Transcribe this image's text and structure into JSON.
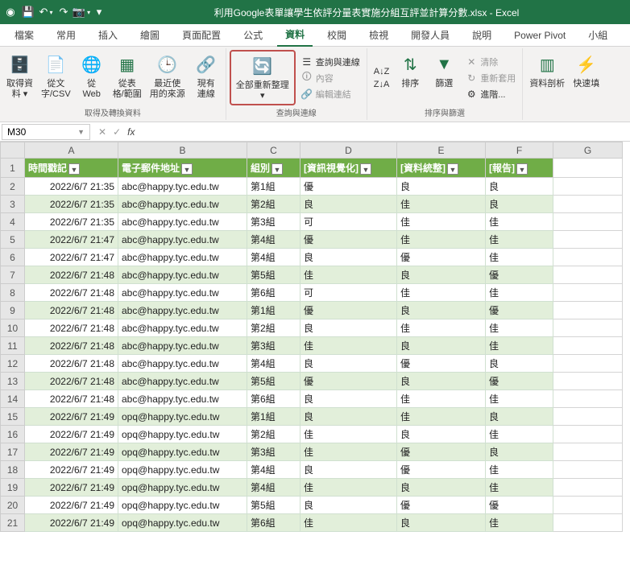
{
  "title": "利用Google表單讓學生依評分量表實施分組互評並計算分數.xlsx - Excel",
  "menuTabs": {
    "file": "檔案",
    "home": "常用",
    "insert": "插入",
    "draw": "繪圖",
    "pageLayout": "頁面配置",
    "formulas": "公式",
    "data": "資料",
    "review": "校閱",
    "view": "檢視",
    "developer": "開發人員",
    "help": "說明",
    "powerPivot": "Power Pivot",
    "team": "小組"
  },
  "ribbon": {
    "getData": "取得資\n料 ▾",
    "fromTextCsv": "從文\n字/CSV",
    "fromWeb": "從\nWeb",
    "fromTable": "從表\n格/範圍",
    "recentSources": "最近使\n用的來源",
    "existingConnections": "現有\n連線",
    "getTransformLabel": "取得及轉換資料",
    "refreshAll": "全部重新整理\n▾",
    "queriesConnections": "查詢與連線",
    "properties": "內容",
    "editLinks": "編輯連結",
    "queriesLabel": "查詢與連線",
    "sortAZ": "A↓Z",
    "sortZA": "Z↓A",
    "sort": "排序",
    "filter": "篩選",
    "clear": "清除",
    "reapply": "重新套用",
    "advanced": "進階...",
    "sortFilterLabel": "排序與篩選",
    "textToColumns": "資料剖析",
    "flashFill": "快速填"
  },
  "nameBox": "M30",
  "columns": [
    "A",
    "B",
    "C",
    "D",
    "E",
    "F",
    "G"
  ],
  "headers": {
    "timestamp": "時間戳記",
    "email": "電子郵件地址",
    "group": "組別",
    "infoVis": "[資訊視覺化]",
    "dataOrg": "[資料統整]",
    "report": "[報告]"
  },
  "rows": [
    {
      "ts": "2022/6/7 21:35",
      "email": "abc@happy.tyc.edu.tw",
      "grp": "第1組",
      "v1": "優",
      "v2": "良",
      "v3": "良"
    },
    {
      "ts": "2022/6/7 21:35",
      "email": "abc@happy.tyc.edu.tw",
      "grp": "第2組",
      "v1": "良",
      "v2": "佳",
      "v3": "良"
    },
    {
      "ts": "2022/6/7 21:35",
      "email": "abc@happy.tyc.edu.tw",
      "grp": "第3組",
      "v1": "可",
      "v2": "佳",
      "v3": "佳"
    },
    {
      "ts": "2022/6/7 21:47",
      "email": "abc@happy.tyc.edu.tw",
      "grp": "第4組",
      "v1": "優",
      "v2": "佳",
      "v3": "佳"
    },
    {
      "ts": "2022/6/7 21:47",
      "email": "abc@happy.tyc.edu.tw",
      "grp": "第4組",
      "v1": "良",
      "v2": "優",
      "v3": "佳"
    },
    {
      "ts": "2022/6/7 21:48",
      "email": "abc@happy.tyc.edu.tw",
      "grp": "第5組",
      "v1": "佳",
      "v2": "良",
      "v3": "優"
    },
    {
      "ts": "2022/6/7 21:48",
      "email": "abc@happy.tyc.edu.tw",
      "grp": "第6組",
      "v1": "可",
      "v2": "佳",
      "v3": "佳"
    },
    {
      "ts": "2022/6/7 21:48",
      "email": "abc@happy.tyc.edu.tw",
      "grp": "第1組",
      "v1": "優",
      "v2": "良",
      "v3": "優"
    },
    {
      "ts": "2022/6/7 21:48",
      "email": "abc@happy.tyc.edu.tw",
      "grp": "第2組",
      "v1": "良",
      "v2": "佳",
      "v3": "佳"
    },
    {
      "ts": "2022/6/7 21:48",
      "email": "abc@happy.tyc.edu.tw",
      "grp": "第3組",
      "v1": "佳",
      "v2": "良",
      "v3": "佳"
    },
    {
      "ts": "2022/6/7 21:48",
      "email": "abc@happy.tyc.edu.tw",
      "grp": "第4組",
      "v1": "良",
      "v2": "優",
      "v3": "良"
    },
    {
      "ts": "2022/6/7 21:48",
      "email": "abc@happy.tyc.edu.tw",
      "grp": "第5組",
      "v1": "優",
      "v2": "良",
      "v3": "優"
    },
    {
      "ts": "2022/6/7 21:48",
      "email": "abc@happy.tyc.edu.tw",
      "grp": "第6組",
      "v1": "良",
      "v2": "佳",
      "v3": "佳"
    },
    {
      "ts": "2022/6/7 21:49",
      "email": "opq@happy.tyc.edu.tw",
      "grp": "第1組",
      "v1": "良",
      "v2": "佳",
      "v3": "良"
    },
    {
      "ts": "2022/6/7 21:49",
      "email": "opq@happy.tyc.edu.tw",
      "grp": "第2組",
      "v1": "佳",
      "v2": "良",
      "v3": "佳"
    },
    {
      "ts": "2022/6/7 21:49",
      "email": "opq@happy.tyc.edu.tw",
      "grp": "第3組",
      "v1": "佳",
      "v2": "優",
      "v3": "良"
    },
    {
      "ts": "2022/6/7 21:49",
      "email": "opq@happy.tyc.edu.tw",
      "grp": "第4組",
      "v1": "良",
      "v2": "優",
      "v3": "佳"
    },
    {
      "ts": "2022/6/7 21:49",
      "email": "opq@happy.tyc.edu.tw",
      "grp": "第4組",
      "v1": "佳",
      "v2": "良",
      "v3": "佳"
    },
    {
      "ts": "2022/6/7 21:49",
      "email": "opq@happy.tyc.edu.tw",
      "grp": "第5組",
      "v1": "良",
      "v2": "優",
      "v3": "優"
    },
    {
      "ts": "2022/6/7 21:49",
      "email": "opq@happy.tyc.edu.tw",
      "grp": "第6組",
      "v1": "佳",
      "v2": "良",
      "v3": "佳"
    }
  ]
}
